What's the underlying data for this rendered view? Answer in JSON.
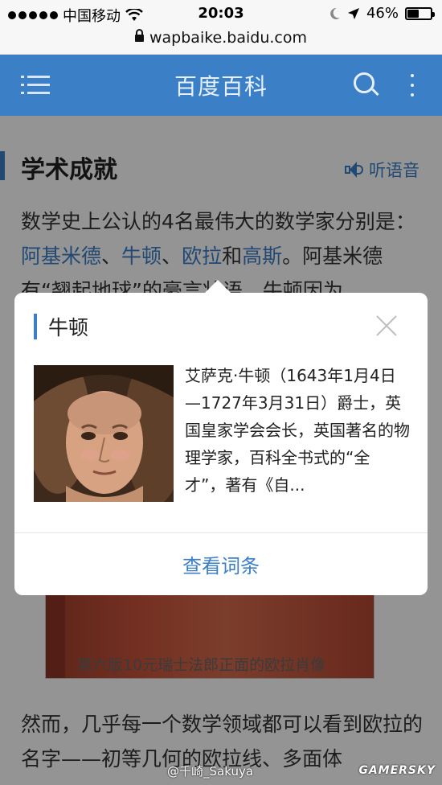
{
  "status_bar": {
    "carrier": "中国移动",
    "time": "20:03",
    "battery": "46%",
    "battery_fraction": 0.46,
    "url": "wapbaike.baidu.com"
  },
  "header": {
    "title": "百度百科",
    "icons": [
      "menu-icon",
      "search-icon",
      "more-icon"
    ]
  },
  "section": {
    "title": "学术成就",
    "listen_label": "听语音"
  },
  "article": {
    "p1_before": "数学史上公认的4名最伟大的数学家分别是：",
    "link1": "阿基米德",
    "sep1": "、",
    "link2": "牛顿",
    "sep2": "、",
    "link3": "欧拉",
    "sep3": "和",
    "link4": "高斯",
    "p1_after": "。阿基米德有“翘起地球”的豪言壮语，牛顿因为",
    "figure_caption": "第六版10元瑞士法郎正面的欧拉肖像",
    "p2": "然而，几乎每一个数学领域都可以看到欧拉的名字——初等几何的欧拉线、多面体"
  },
  "popup": {
    "title": "牛顿",
    "description": "艾萨克·牛顿（1643年1月4日—1727年3月31日）爵士，英国皇家学会会长，英国著名的物理学家，百科全书式的“全才”，著有《自...",
    "action_label": "查看词条"
  },
  "watermark": {
    "weibo": "@千崎_Sakuya",
    "logo": "GAMERSKY"
  },
  "colors": {
    "accent": "#3b7fc6",
    "header_bg": "#3b7fc6"
  }
}
